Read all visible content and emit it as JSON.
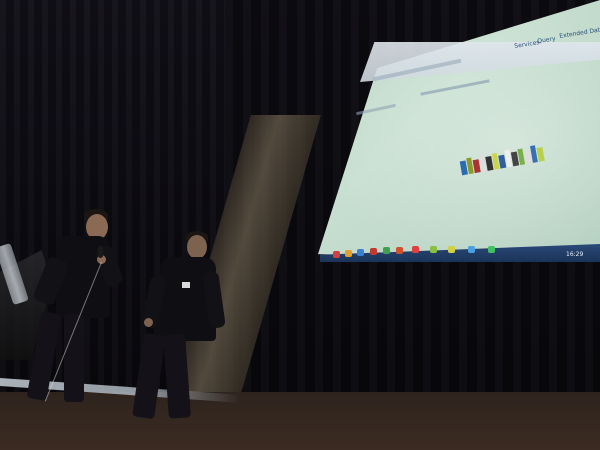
{
  "scene": {
    "description_colors": {
      "screen": "#bcd7c7",
      "taskbar": "#1b3358",
      "curtain": "#0b0a10",
      "floor": "#3b2b22"
    }
  },
  "projected_screen": {
    "nav_items": [
      "Services",
      "Query",
      "Extended Data"
    ],
    "taskbar_clock": "16:29"
  },
  "icons": {
    "logo": "project-logo-icon"
  }
}
